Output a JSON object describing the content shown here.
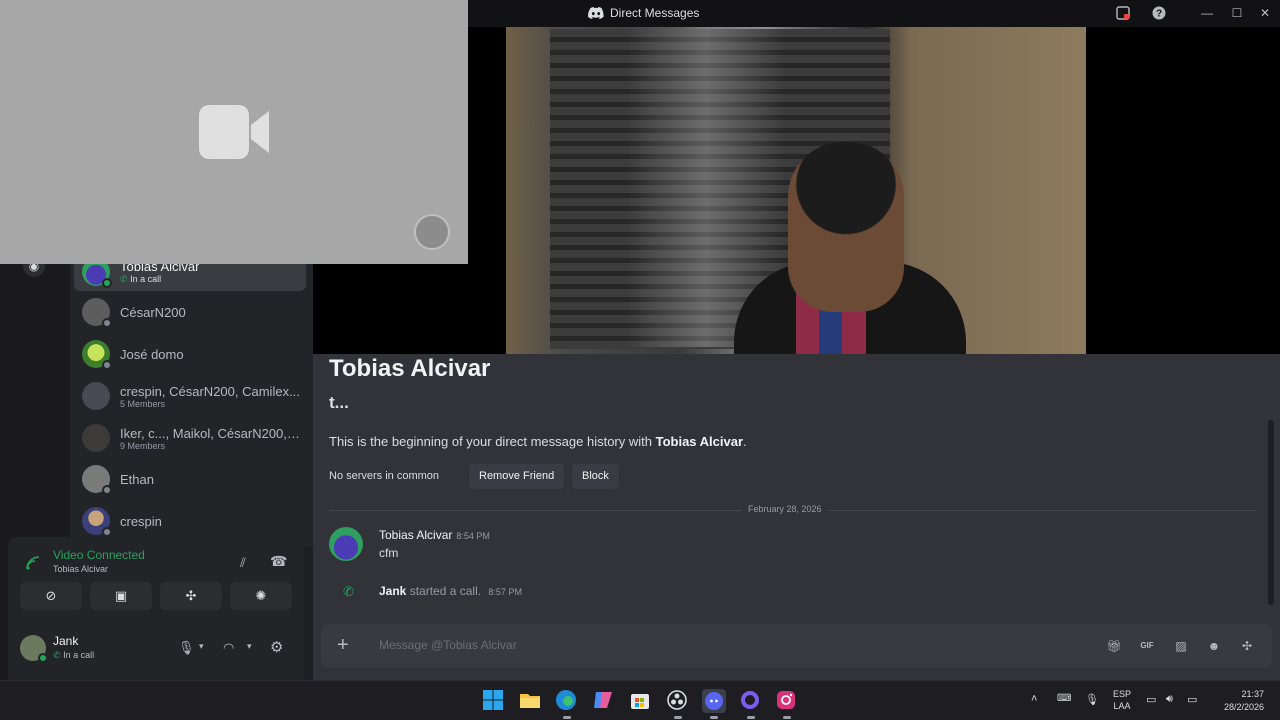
{
  "window": {
    "title": "Direct Messages"
  },
  "dm_list": [
    {
      "name": "Tobias Alcivar",
      "sub": "In a call",
      "active": true,
      "status": "online"
    },
    {
      "name": "CésarN200",
      "sub": "",
      "status": "offline"
    },
    {
      "name": "José domo",
      "sub": "",
      "status": "offline"
    },
    {
      "name": "crespin, CésarN200, Camilex...",
      "sub": "5 Members",
      "status": ""
    },
    {
      "name": "Iker, c..., Maikol, CésarN200, ...",
      "sub": "9 Members",
      "status": ""
    },
    {
      "name": "Ethan",
      "sub": "",
      "status": "offline"
    },
    {
      "name": "crespin",
      "sub": "",
      "status": "offline"
    }
  ],
  "voice": {
    "status": "Video Connected",
    "channel": "Tobias Alcivar"
  },
  "user": {
    "name": "Jank",
    "status": "In a call"
  },
  "chat": {
    "recipient": "Tobias Alcivar",
    "username": "t...",
    "intro_prefix": "This is the beginning of your direct message history with ",
    "intro_name": "Tobias Alcivar",
    "no_servers": "No servers in common",
    "remove_friend": "Remove Friend",
    "block": "Block",
    "date_divider": "February 28, 2026",
    "messages": [
      {
        "author": "Tobias Alcivar",
        "time": "8:54 PM",
        "text": "cfm"
      }
    ],
    "system": {
      "author": "Jank",
      "text": "started a call.",
      "time": "8:57 PM"
    },
    "composer_placeholder": "Message @Tobias Alcivar"
  },
  "taskbar": {
    "lang_line1": "ESP",
    "lang_line2": "LAA",
    "time": "21:37",
    "date": "28/2/2026"
  },
  "colors": {
    "green": "#23a55a",
    "accent": "#5865f2",
    "background": "#323339"
  }
}
